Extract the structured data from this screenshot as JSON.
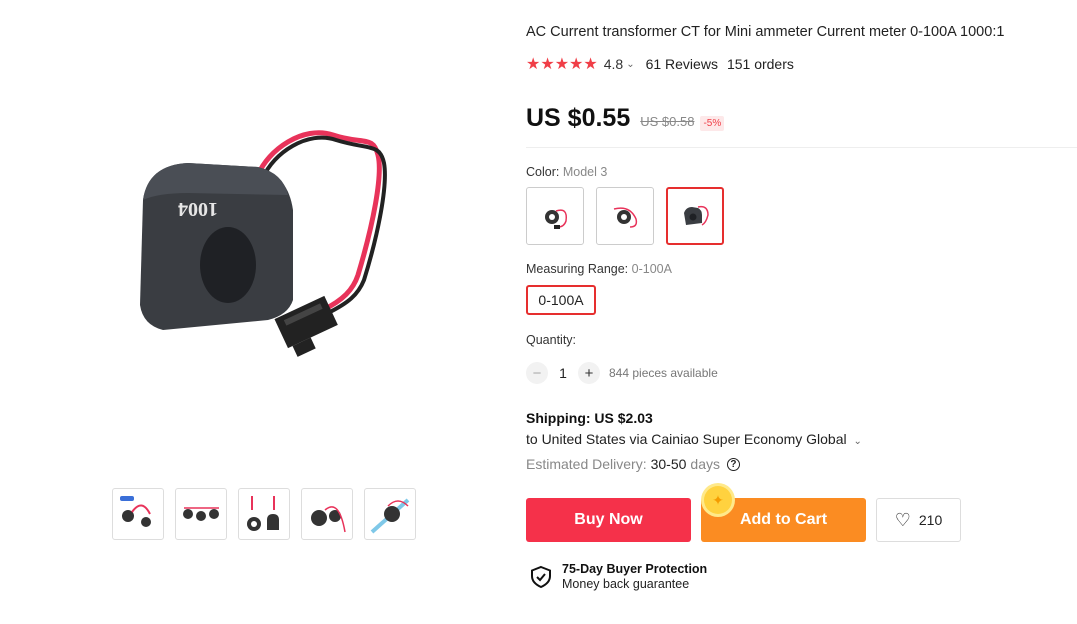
{
  "product": {
    "title": "AC Current transformer CT for Mini ammeter Current meter 0-100A 1000:1",
    "rating": "4.8",
    "stars": "★★★★★",
    "reviews": "61 Reviews",
    "orders": "151 orders",
    "image_label": "1004"
  },
  "price": {
    "current": "US $0.55",
    "original": "US $0.58",
    "discount": "-5%"
  },
  "color": {
    "label": "Color:",
    "selected": "Model 3",
    "options": [
      "model-1",
      "model-2",
      "model-3"
    ]
  },
  "range": {
    "label": "Measuring Range:",
    "selected": "0-100A",
    "option": "0-100A"
  },
  "quantity": {
    "label": "Quantity:",
    "value": "1",
    "minus": "−",
    "plus": "+",
    "available": "844 pieces available"
  },
  "shipping": {
    "title": "Shipping: US $2.03",
    "route": "to United States via Cainiao Super Economy Global",
    "chevron": "⌄",
    "delivery_label": "Estimated Delivery:",
    "delivery_days": "30-50",
    "delivery_unit": "days",
    "help": "?"
  },
  "actions": {
    "buy_now": "Buy Now",
    "add_to_cart": "Add to Cart",
    "wishlist_count": "210"
  },
  "protection": {
    "title": "75-Day Buyer Protection",
    "subtitle": "Money back guarantee"
  },
  "colors": {
    "accent_red": "#f5314a",
    "accent_orange": "#fb8c22",
    "star_red": "#f03e47"
  }
}
